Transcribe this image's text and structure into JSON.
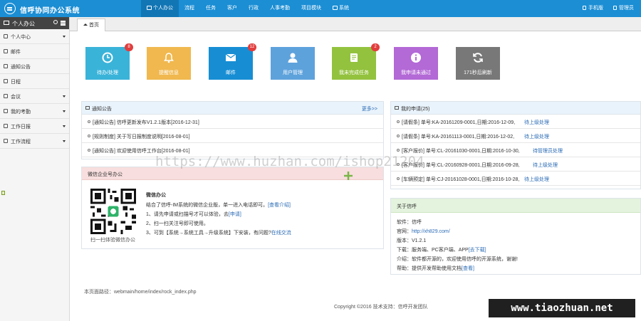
{
  "app": {
    "title": "信呼协同办公系统"
  },
  "topnav": [
    {
      "label": "个人办公",
      "active": true
    },
    {
      "label": "流程"
    },
    {
      "label": "任务"
    },
    {
      "label": "客户"
    },
    {
      "label": "行政"
    },
    {
      "label": "人事考勤"
    },
    {
      "label": "项目模块"
    },
    {
      "label": "系统"
    }
  ],
  "topright": {
    "mobile": "手机版",
    "user": "管理员"
  },
  "sidebar": {
    "title": "个人办公",
    "items": [
      {
        "label": "个人中心",
        "expandable": true
      },
      {
        "label": "邮件"
      },
      {
        "label": "通知公告"
      },
      {
        "label": "日程"
      },
      {
        "label": "会议",
        "expandable": true
      },
      {
        "label": "我的考勤",
        "expandable": true
      },
      {
        "label": "工作日报",
        "expandable": true
      },
      {
        "label": "工作流程",
        "expandable": true
      }
    ]
  },
  "tabs": [
    {
      "label": "首页"
    }
  ],
  "tiles": [
    {
      "label": "待办/处理",
      "badge": "8",
      "color": "#3ab3d9",
      "icon": "clock-icon"
    },
    {
      "label": "提醒信息",
      "badge": "",
      "color": "#f0b84f",
      "icon": "bell-icon"
    },
    {
      "label": "邮件",
      "badge": "12",
      "color": "#178ed4",
      "icon": "envelope-icon"
    },
    {
      "label": "用户管理",
      "badge": "",
      "color": "#5ea2dc",
      "icon": "user-icon"
    },
    {
      "label": "我未完成任务",
      "badge": "2",
      "color": "#93c23f",
      "icon": "book-icon"
    },
    {
      "label": "我申请未通过",
      "badge": "",
      "color": "#b369d6",
      "icon": "info-icon"
    },
    {
      "label": "171秒后刷新",
      "badge": "",
      "color": "#787878",
      "icon": "refresh-icon"
    }
  ],
  "notices": {
    "title": "通知公告",
    "more": "更多>>",
    "items": [
      "[通知公告] 信呼更新发布V1.2.1版本[2016-12-31]",
      "[规则制度] 关于写日报制度说明[2016-08-01]",
      "[通知公告] 欢迎使用信呼工作台[2016-08-01]"
    ]
  },
  "applications": {
    "title": "我的申请(25)",
    "items": [
      {
        "text": "[请假条] 单号:KA-20161209-0001,日期:2016-12-09,",
        "status": "待上级处理"
      },
      {
        "text": "[请假条] 单号:KA-20161113-0001,日期:2016-12-02,",
        "status": "待上级处理"
      },
      {
        "text": "[客户报价] 单号:CL-20161030-0001,日期:2016-10-30,",
        "status": "待管理员处理"
      },
      {
        "text": "[客户报价] 单号:CL-20160928-0001,日期:2016-09-28,",
        "status": "待上级处理"
      },
      {
        "text": "[车辆预定] 单号:CJ-20161028-0001,日期:2016-10-28,",
        "status": "待上级处理"
      }
    ]
  },
  "wechat": {
    "title": "微信企业号办公",
    "name": "微信办公",
    "line1": "结合了信呼-IM系统的微信企业版，单一进入电话即可。",
    "link1": "[查看介绍]",
    "line2": "1、请先申请或扫描号才可以体验，去",
    "link2": "[申请]",
    "line3": "2、扫一扫关注号即可使用。",
    "line4": "3、可到【系统→系统工具→升级系统】下安装，有问题?",
    "link4": "在线交流",
    "caption": "扫一扫体验微信办公"
  },
  "about": {
    "title": "关于信呼",
    "lines": [
      {
        "label": "软件：",
        "value": "信呼",
        "link": ""
      },
      {
        "label": "官网：",
        "value": "",
        "link": "http://xh829.com/"
      },
      {
        "label": "版本：",
        "value": "V1.2.1",
        "link": ""
      },
      {
        "label": "下载：",
        "value": "服务端、PC客户端、APP",
        "link": "[去下载]"
      },
      {
        "label": "介绍：",
        "value": "软件都开源的，欢迎使用信呼的开源系统，谢谢!",
        "link": ""
      },
      {
        "label": "帮助：",
        "value": "提供开发帮助使用文档",
        "link": "[查看]"
      }
    ]
  },
  "footer": {
    "path": "本页面路径：webmain/home/index/rock_index.php",
    "copyright": "Copyright ©2016 技术支持：信呼开发团队"
  },
  "watermarks": {
    "center": "https://www.huzhan.com/ishop21204",
    "corner": "www.tiaozhuan.net"
  }
}
